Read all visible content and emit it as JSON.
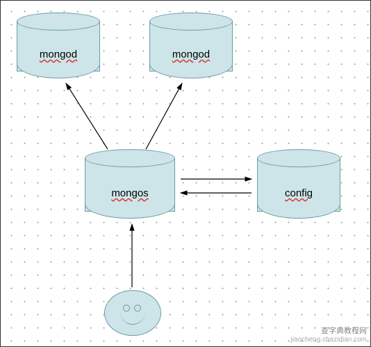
{
  "chart_data": {
    "type": "diagram",
    "title": "",
    "nodes": [
      {
        "id": "mongod1",
        "label": "mongod",
        "shape": "cylinder"
      },
      {
        "id": "mongod2",
        "label": "mongod",
        "shape": "cylinder"
      },
      {
        "id": "mongos",
        "label": "mongos",
        "shape": "cylinder"
      },
      {
        "id": "config",
        "label": "config",
        "shape": "cylinder"
      },
      {
        "id": "client",
        "label": "",
        "shape": "smiley-face"
      }
    ],
    "edges": [
      {
        "from": "mongos",
        "to": "mongod1",
        "direction": "to"
      },
      {
        "from": "mongos",
        "to": "mongod2",
        "direction": "to"
      },
      {
        "from": "mongos",
        "to": "config",
        "direction": "both"
      },
      {
        "from": "client",
        "to": "mongos",
        "direction": "to"
      }
    ]
  },
  "labels": {
    "mongod1": "mongod",
    "mongod2": "mongod",
    "mongos": "mongos",
    "config": "config"
  },
  "watermark": {
    "line1": "查字典教程网",
    "line2": "jiaocheng.chazidian.com"
  }
}
